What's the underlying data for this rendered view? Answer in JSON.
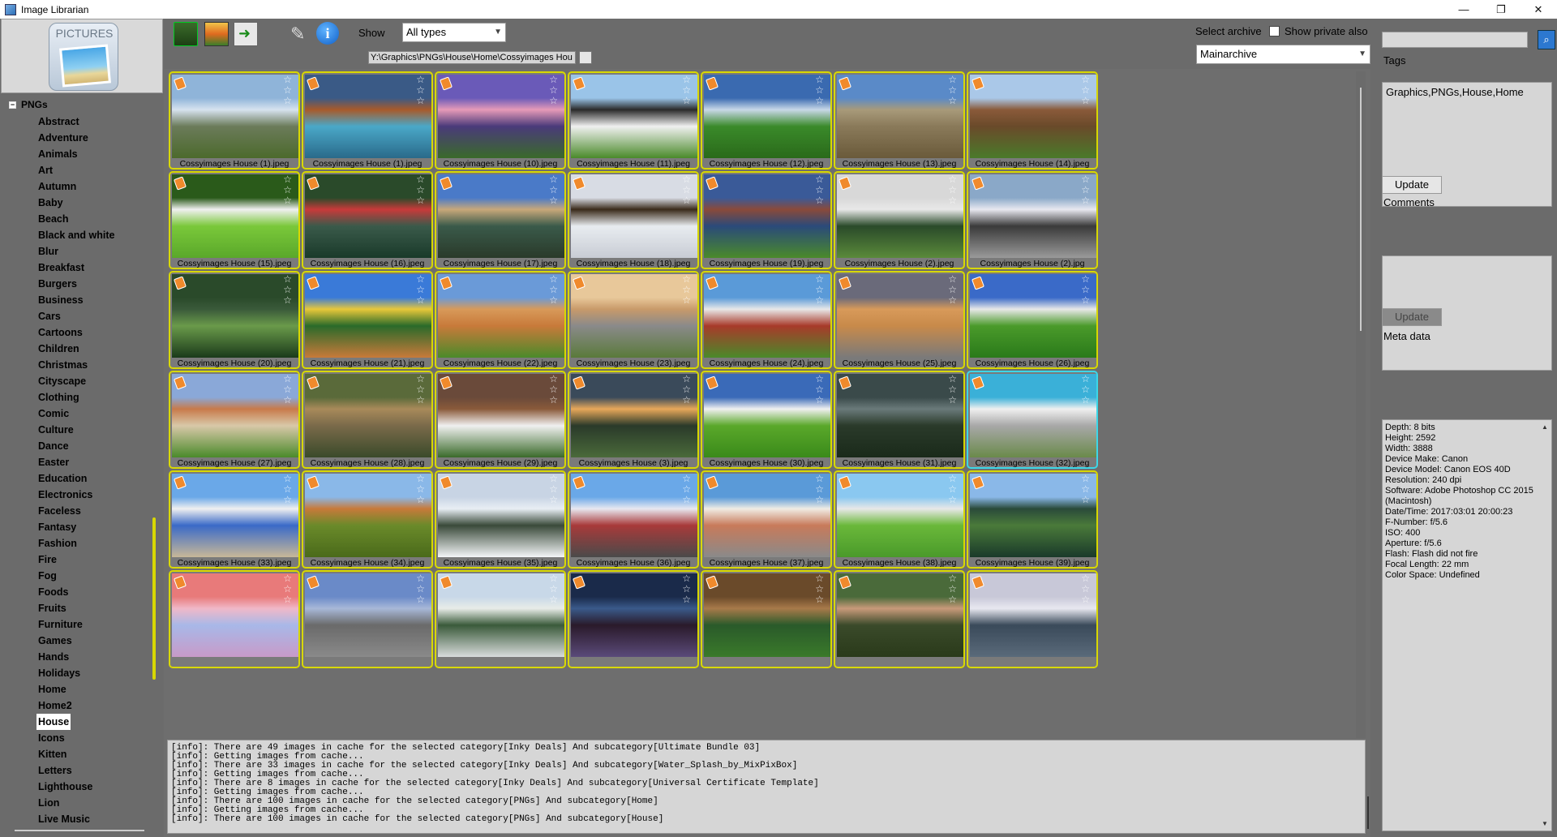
{
  "window": {
    "title": "Image Librarian",
    "buttons": [
      "—",
      "❐",
      "✕"
    ]
  },
  "logo": {
    "text": "PICTURES"
  },
  "tree": {
    "root": "PNGs",
    "toggle": "−",
    "items": [
      "Abstract",
      "Adventure",
      "Animals",
      "Art",
      "Autumn",
      "Baby",
      "Beach",
      "Black and white",
      "Blur",
      "Breakfast",
      "Burgers",
      "Business",
      "Cars",
      "Cartoons",
      "Children",
      "Christmas",
      "Cityscape",
      "Clothing",
      "Comic",
      "Culture",
      "Dance",
      "Easter",
      "Education",
      "Electronics",
      "Faceless",
      "Fantasy",
      "Fashion",
      "Fire",
      "Fog",
      "Foods",
      "Fruits",
      "Furniture",
      "Games",
      "Hands",
      "Holidays",
      "Home",
      "Home2",
      "House",
      "Icons",
      "Kitten",
      "Letters",
      "Lighthouse",
      "Lion",
      "Live Music"
    ],
    "selected": "House"
  },
  "toolbar": {
    "show_label": "Show",
    "type_value": "All types",
    "path": "Y:\\Graphics\\PNGs\\House\\Home\\Cossyimages Hou",
    "select_archive_label": "Select archive",
    "show_private_label": "Show private also",
    "archive_value": "Mainarchive"
  },
  "right": {
    "search_placeholder": "",
    "search_icon": "search-icon",
    "tags_label": "Tags",
    "tags_value": "Graphics,PNGs,House,Home",
    "update_label": "Update",
    "comments_label": "Comments",
    "update2_label": "Update",
    "meta_label": "Meta data",
    "meta": [
      "Depth: 8 bits",
      "Height: 2592",
      "Width: 3888",
      "Device Make: Canon",
      "Device Model: Canon EOS 40D",
      "Resolution: 240 dpi",
      "Software: Adobe Photoshop CC 2015 (Macintosh)",
      "Date/Time: 2017:03:01 20:00:23",
      "F-Number: f/5.6",
      "ISO: 400",
      "Aperture: f/5.6",
      "Flash: Flash did not fire",
      "Focal Length: 22 mm",
      "Color Space: Undefined"
    ]
  },
  "images": [
    {
      "caption": "Cossyimages House (1).jpeg",
      "palette": [
        "#8fb4d9",
        "#d7e3ef",
        "#6b7b5a",
        "#4c6a2c"
      ]
    },
    {
      "caption": "Cossyimages House (1).jpeg",
      "palette": [
        "#3a5a86",
        "#a85a2a",
        "#4aa8c8",
        "#2a6a8a"
      ]
    },
    {
      "caption": "Cossyimages House (10).jpeg",
      "palette": [
        "#6a5ab8",
        "#e69ab8",
        "#4a3a7a",
        "#3a6a2a"
      ]
    },
    {
      "caption": "Cossyimages House (11).jpeg",
      "palette": [
        "#9ac4e8",
        "#2a2a2a",
        "#f0f0f0",
        "#4a8a2a"
      ]
    },
    {
      "caption": "Cossyimages House (12).jpeg",
      "palette": [
        "#3a6ab0",
        "#c8d8e8",
        "#3a8a2a",
        "#2a6a1a"
      ]
    },
    {
      "caption": "Cossyimages House (13).jpeg",
      "palette": [
        "#5a8ac8",
        "#a89a7a",
        "#8a7a5a",
        "#6a5a3a"
      ]
    },
    {
      "caption": "Cossyimages House (14).jpeg",
      "palette": [
        "#aac8e8",
        "#8a5a3a",
        "#6a4a2a",
        "#4a7a2a"
      ]
    },
    {
      "caption": "Cossyimages House (15).jpeg",
      "palette": [
        "#2a5a1a",
        "#f0f0f0",
        "#7ac83a",
        "#5aa82a"
      ]
    },
    {
      "caption": "Cossyimages House (16).jpeg",
      "palette": [
        "#2a4a2a",
        "#c83a3a",
        "#3a5a4a",
        "#1a3a2a"
      ]
    },
    {
      "caption": "Cossyimages House (17).jpeg",
      "palette": [
        "#4a7ac8",
        "#c8a87a",
        "#3a5a4a",
        "#2a3a2a"
      ]
    },
    {
      "caption": "Cossyimages House (18).jpeg",
      "palette": [
        "#d8dce4",
        "#3a2a1a",
        "#e8ecf0",
        "#c8ccd4"
      ]
    },
    {
      "caption": "Cossyimages House (19).jpeg",
      "palette": [
        "#3a5a98",
        "#8a4a3a",
        "#2a4a7a",
        "#4a8a2a"
      ]
    },
    {
      "caption": "Cossyimages House (2).jpeg",
      "palette": [
        "#d8d8d8",
        "#e8e8e8",
        "#2a4a2a",
        "#5a8a3a"
      ]
    },
    {
      "caption": "Cossyimages House (2).jpg",
      "palette": [
        "#8aa8c8",
        "#e8e8f0",
        "#3a3a3a",
        "#9a9a9a"
      ]
    },
    {
      "caption": "Cossyimages House (20).jpeg",
      "palette": [
        "#2a4a2a",
        "#3a5a3a",
        "#6a9a4a",
        "#1a3a1a"
      ]
    },
    {
      "caption": "Cossyimages House (21).jpeg",
      "palette": [
        "#3a7ad8",
        "#e8c83a",
        "#2a6a2a",
        "#c87a3a"
      ]
    },
    {
      "caption": "Cossyimages House (22).jpeg",
      "palette": [
        "#6a9ad8",
        "#d89a5a",
        "#c87a3a",
        "#4a8a2a"
      ]
    },
    {
      "caption": "Cossyimages House (23).jpeg",
      "palette": [
        "#e8c89a",
        "#c89a6a",
        "#8a8a8a",
        "#5a7a3a"
      ]
    },
    {
      "caption": "Cossyimages House (24).jpeg",
      "palette": [
        "#5a9ad8",
        "#e8e8e8",
        "#a83a2a",
        "#4a8a2a"
      ]
    },
    {
      "caption": "Cossyimages House (25).jpeg",
      "palette": [
        "#6a6a7a",
        "#d89a5a",
        "#c88a4a",
        "#7a7a7a"
      ]
    },
    {
      "caption": "Cossyimages House (26).jpeg",
      "palette": [
        "#3a6ac8",
        "#e8e8e8",
        "#4a9a2a",
        "#2a7a1a"
      ]
    },
    {
      "caption": "Cossyimages House (27).jpeg",
      "palette": [
        "#8aa8d8",
        "#c87a4a",
        "#d8c8a8",
        "#4a8a2a"
      ]
    },
    {
      "caption": "Cossyimages House (28).jpeg",
      "palette": [
        "#5a6a3a",
        "#a88a5a",
        "#7a6a4a",
        "#3a4a2a"
      ]
    },
    {
      "caption": "Cossyimages House (29).jpeg",
      "palette": [
        "#6a4a3a",
        "#8a5a3a",
        "#f0f0f0",
        "#3a6a2a"
      ]
    },
    {
      "caption": "Cossyimages House (3).jpeg",
      "palette": [
        "#3a4a5a",
        "#e8a85a",
        "#2a3a2a",
        "#4a6a3a"
      ]
    },
    {
      "caption": "Cossyimages House (30).jpeg",
      "palette": [
        "#3a6ab8",
        "#f0f0f0",
        "#5aa82a",
        "#3a8a1a"
      ]
    },
    {
      "caption": "Cossyimages House (31).jpeg",
      "palette": [
        "#3a4a4a",
        "#6a7a7a",
        "#2a3a2a",
        "#1a2a1a"
      ]
    },
    {
      "caption": "Cossyimages House (32).jpeg",
      "palette": [
        "#3ab0d8",
        "#f0f0f0",
        "#a8a8a8",
        "#6a8a4a"
      ]
    },
    {
      "caption": "Cossyimages House (33).jpeg",
      "palette": [
        "#6aa8e8",
        "#f0f0f0",
        "#3a6ac8",
        "#c8b898"
      ]
    },
    {
      "caption": "Cossyimages House (34).jpeg",
      "palette": [
        "#8ab8e8",
        "#c87a3a",
        "#6a8a2a",
        "#4a6a1a"
      ]
    },
    {
      "caption": "Cossyimages House (35).jpeg",
      "palette": [
        "#c8d4e4",
        "#e8eef4",
        "#3a4a3a",
        "#f4f6f8"
      ]
    },
    {
      "caption": "Cossyimages House (36).jpeg",
      "palette": [
        "#6aa8e8",
        "#e8e8f0",
        "#a83a3a",
        "#4a4a4a"
      ]
    },
    {
      "caption": "Cossyimages House (37).jpeg",
      "palette": [
        "#5a9ad8",
        "#f0ece4",
        "#c87a5a",
        "#8a8a8a"
      ]
    },
    {
      "caption": "Cossyimages House (38).jpeg",
      "palette": [
        "#8ac8f0",
        "#e8e8e8",
        "#6ab83a",
        "#4a9a2a"
      ]
    },
    {
      "caption": "Cossyimages House (39).jpeg",
      "palette": [
        "#8ab8e8",
        "#2a4a3a",
        "#4a7a3a",
        "#1a3a2a"
      ]
    },
    {
      "caption": "",
      "palette": [
        "#e87a7a",
        "#f0b8c8",
        "#a8b8e8",
        "#c89ac8"
      ]
    },
    {
      "caption": "",
      "palette": [
        "#6a8ac8",
        "#a8b8d8",
        "#6a6a6a",
        "#8a8a8a"
      ]
    },
    {
      "caption": "",
      "palette": [
        "#c8d8e8",
        "#e8ece8",
        "#3a5a3a",
        "#d8dcdc"
      ]
    },
    {
      "caption": "",
      "palette": [
        "#1a2a4a",
        "#3a5a8a",
        "#2a1a2a",
        "#5a4a7a"
      ]
    },
    {
      "caption": "",
      "palette": [
        "#6a4a2a",
        "#a87a4a",
        "#2a5a2a",
        "#3a7a2a"
      ]
    },
    {
      "caption": "",
      "palette": [
        "#4a6a3a",
        "#c89a7a",
        "#3a4a2a",
        "#2a3a1a"
      ]
    },
    {
      "caption": "",
      "palette": [
        "#c8c8d8",
        "#e8e8f0",
        "#3a4a5a",
        "#5a6a7a"
      ]
    }
  ],
  "log": [
    "[info]: There are 49 images in cache for the selected category[Inky Deals] And subcategory[Ultimate Bundle 03]",
    "[info]: Getting images from cache...",
    "[info]: There are 33 images in cache for the selected category[Inky Deals] And subcategory[Water_Splash_by_MixPixBox]",
    "[info]: Getting images from cache...",
    "[info]: There are 8 images in cache for the selected category[Inky Deals] And subcategory[Universal Certificate Template]",
    "[info]: Getting images from cache...",
    "[info]: There are 100 images in cache for the selected category[PNGs] And subcategory[Home]",
    "[info]: Getting images from cache...",
    "[info]: There are 100 images in cache for the selected category[PNGs] And subcategory[House]"
  ],
  "selected_image_index": 27
}
